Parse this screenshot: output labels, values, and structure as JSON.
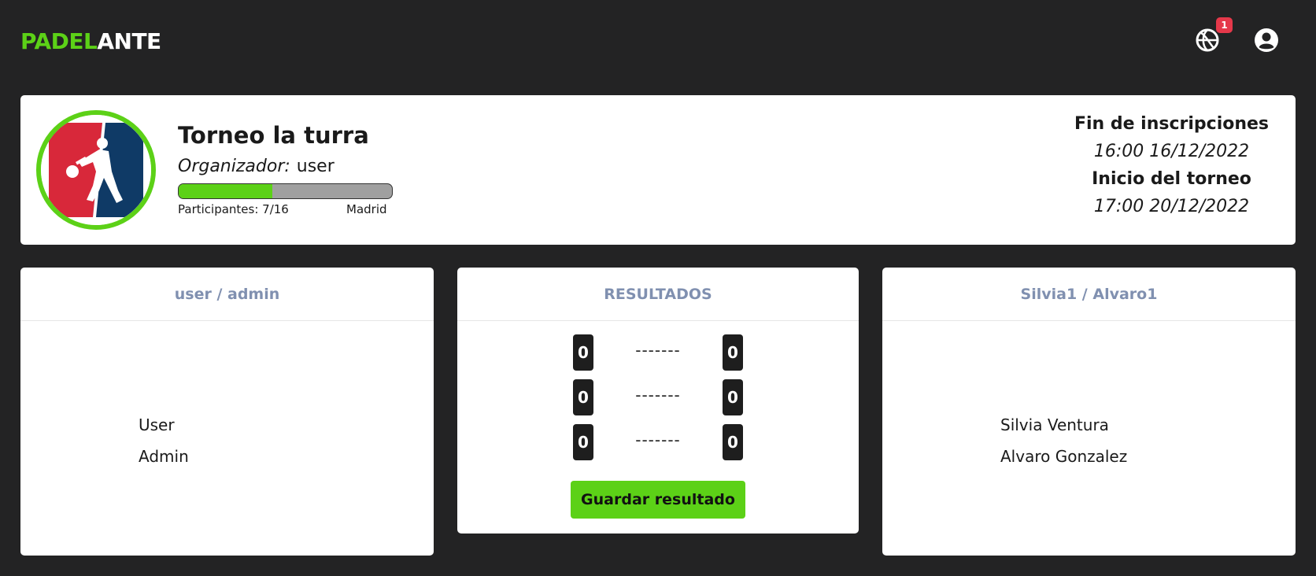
{
  "header": {
    "brand_part1": "PADEL",
    "brand_part2": "ANTE",
    "notification_count": "1",
    "icons": [
      "basketball-icon",
      "user-circle-icon"
    ]
  },
  "tournament": {
    "title": "Torneo la turra",
    "organizer_label": "Organizador:",
    "organizer": "user",
    "participants": "Participantes: 7/16",
    "progress_fraction": 0.4375,
    "city": "Madrid",
    "registration_end_label": "Fin de inscripciones",
    "registration_end": "16:00 16/12/2022",
    "start_label": "Inicio del torneo",
    "start": "17:00 20/12/2022"
  },
  "team_left": {
    "title": "user / admin",
    "players": [
      "User",
      "Admin"
    ]
  },
  "results": {
    "title": "RESULTADOS",
    "sets": [
      {
        "left": "0",
        "separator": "-------",
        "right": "0"
      },
      {
        "left": "0",
        "separator": "-------",
        "right": "0"
      },
      {
        "left": "0",
        "separator": "-------",
        "right": "0"
      }
    ],
    "save_label": "Guardar resultado"
  },
  "team_right": {
    "title": "Silvia1 / Alvaro1",
    "players": [
      "Silvia Ventura",
      "Alvaro Gonzalez"
    ]
  },
  "colors": {
    "accent": "#5cd117",
    "background": "#232324",
    "badge": "#e5384a",
    "card_header_text": "#8090b0"
  }
}
